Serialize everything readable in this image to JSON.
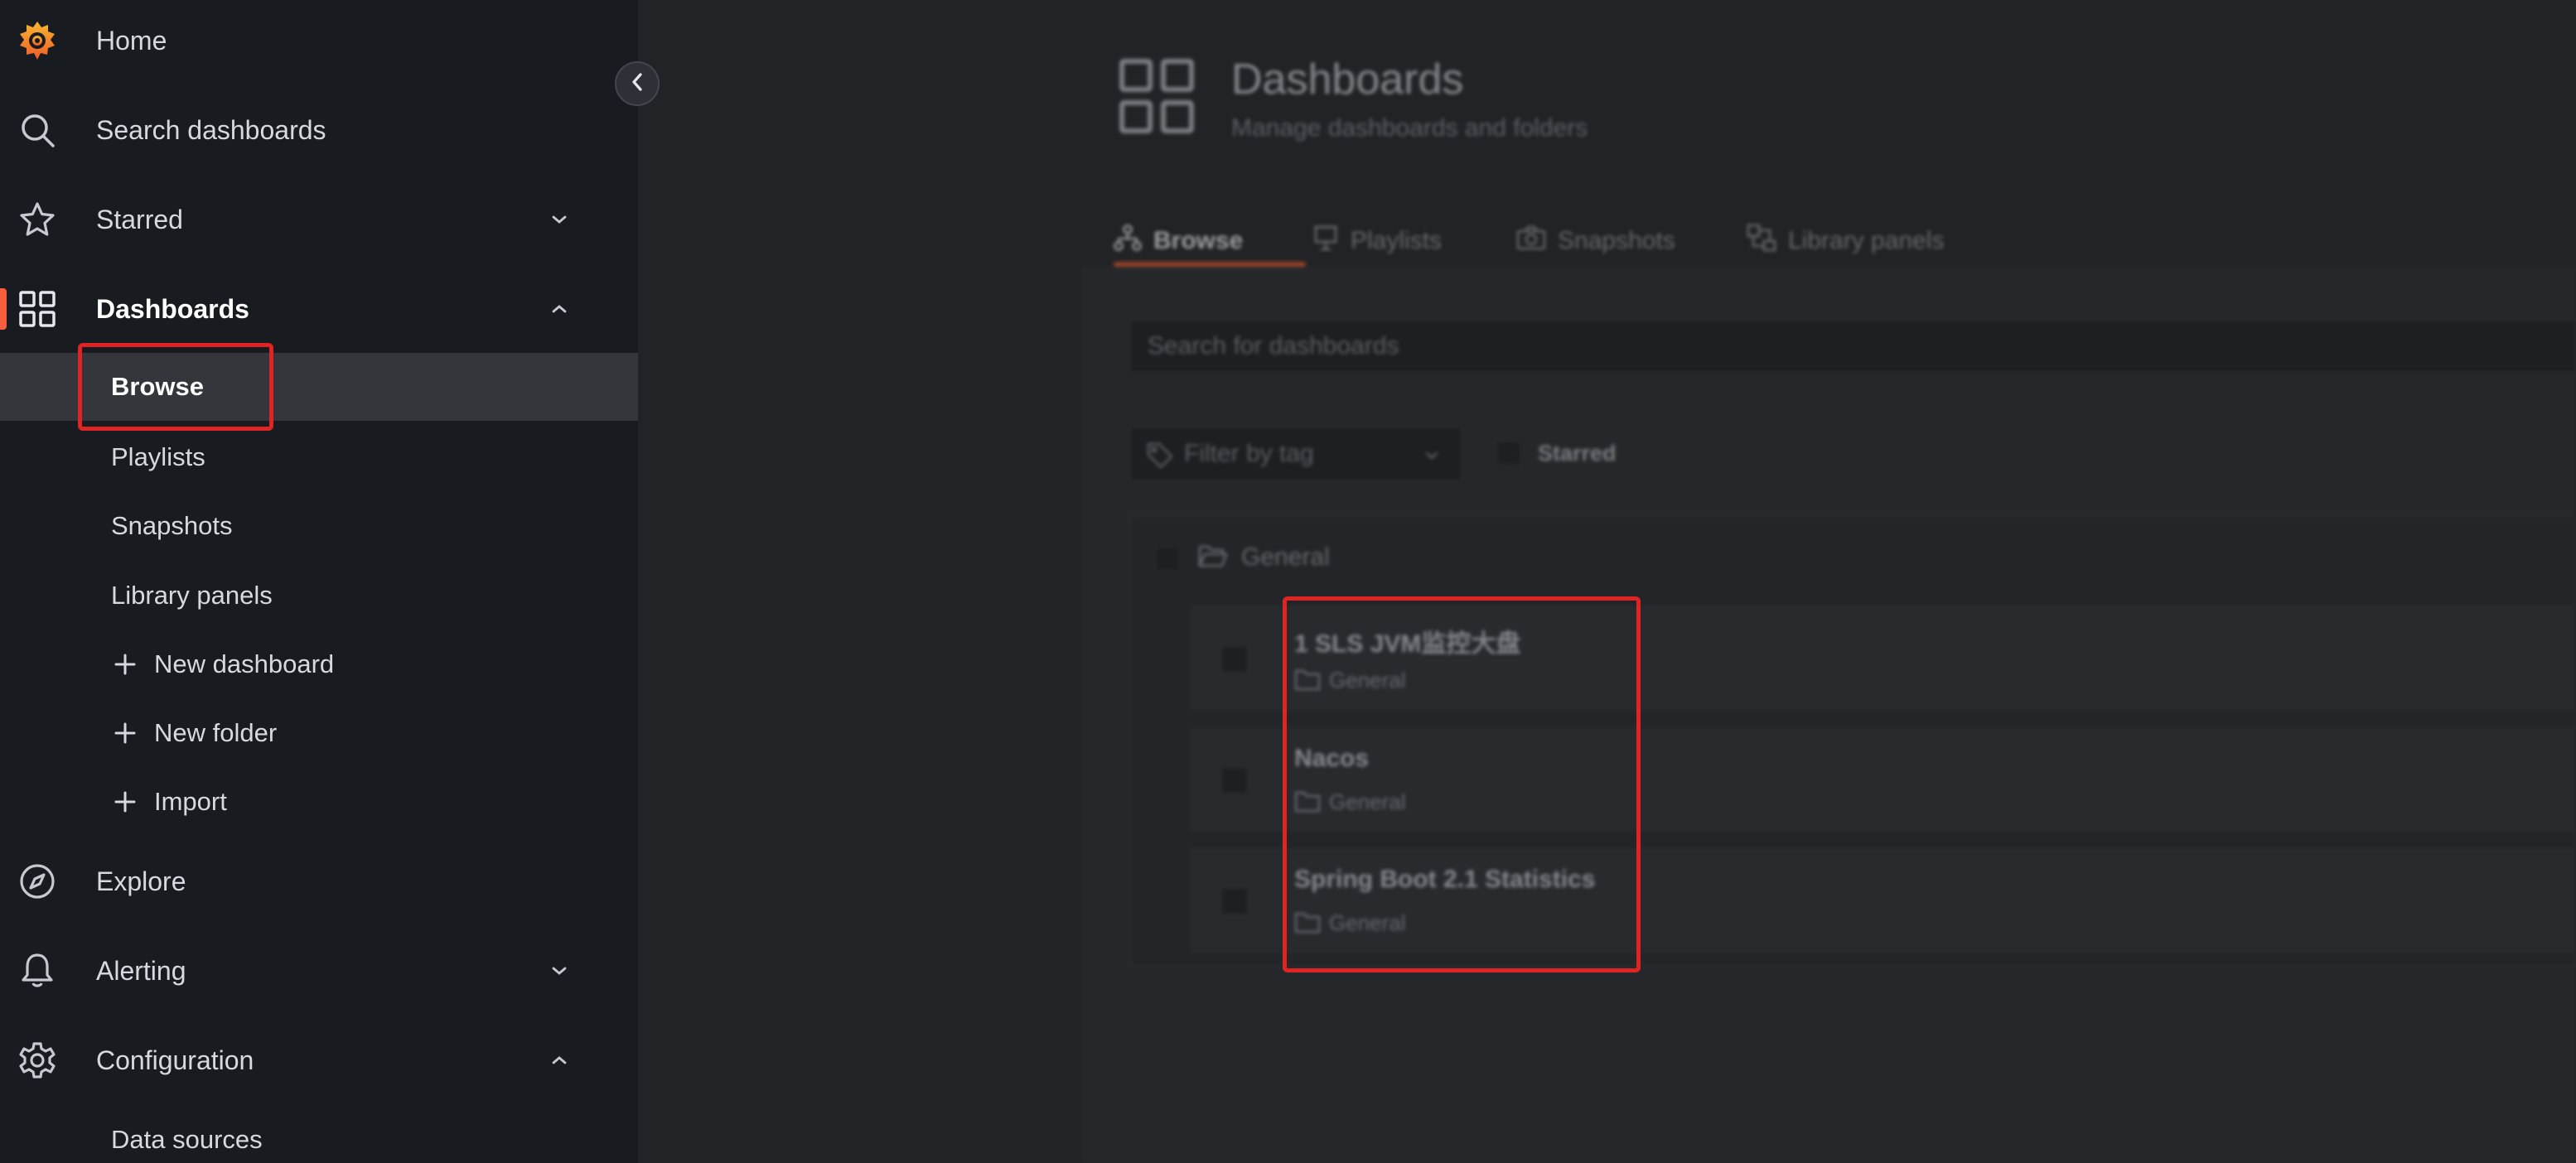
{
  "sidebar": {
    "items": [
      {
        "label": "Home",
        "icon": "grafana-logo-icon"
      },
      {
        "label": "Search dashboards",
        "icon": "search-icon"
      },
      {
        "label": "Starred",
        "icon": "star-icon",
        "chevron": "down"
      },
      {
        "label": "Dashboards",
        "icon": "apps-grid-icon",
        "chevron": "up",
        "active": true
      },
      {
        "label": "Explore",
        "icon": "compass-icon"
      },
      {
        "label": "Alerting",
        "icon": "bell-icon",
        "chevron": "down"
      },
      {
        "label": "Configuration",
        "icon": "gear-icon",
        "chevron": "up"
      }
    ],
    "dashboards_sub": [
      {
        "label": "Browse",
        "selected": true
      },
      {
        "label": "Playlists"
      },
      {
        "label": "Snapshots"
      },
      {
        "label": "Library panels"
      },
      {
        "label": "New dashboard",
        "prefix": "plus"
      },
      {
        "label": "New folder",
        "prefix": "plus"
      },
      {
        "label": "Import",
        "prefix": "plus"
      }
    ],
    "configuration_sub": [
      {
        "label": "Data sources"
      }
    ]
  },
  "main": {
    "title": "Dashboards",
    "subtitle": "Manage dashboards and folders",
    "tabs": [
      {
        "label": "Browse",
        "icon": "sitemap-icon",
        "active": true
      },
      {
        "label": "Playlists",
        "icon": "presentation-icon"
      },
      {
        "label": "Snapshots",
        "icon": "camera-icon"
      },
      {
        "label": "Library panels",
        "icon": "library-panels-icon"
      }
    ],
    "search": {
      "placeholder": "Search for dashboards"
    },
    "filter": {
      "placeholder": "Filter by tag"
    },
    "starred_label": "Starred",
    "folder": {
      "name": "General"
    },
    "dashboards": [
      {
        "title": "1 SLS JVM监控大盘",
        "folder": "General"
      },
      {
        "title": "Nacos",
        "folder": "General"
      },
      {
        "title": "Spring Boot 2.1 Statistics",
        "folder": "General"
      }
    ]
  },
  "colors": {
    "accent": "#f55f3e",
    "highlight": "#e02424",
    "sidebar_bg": "#181b1f"
  }
}
